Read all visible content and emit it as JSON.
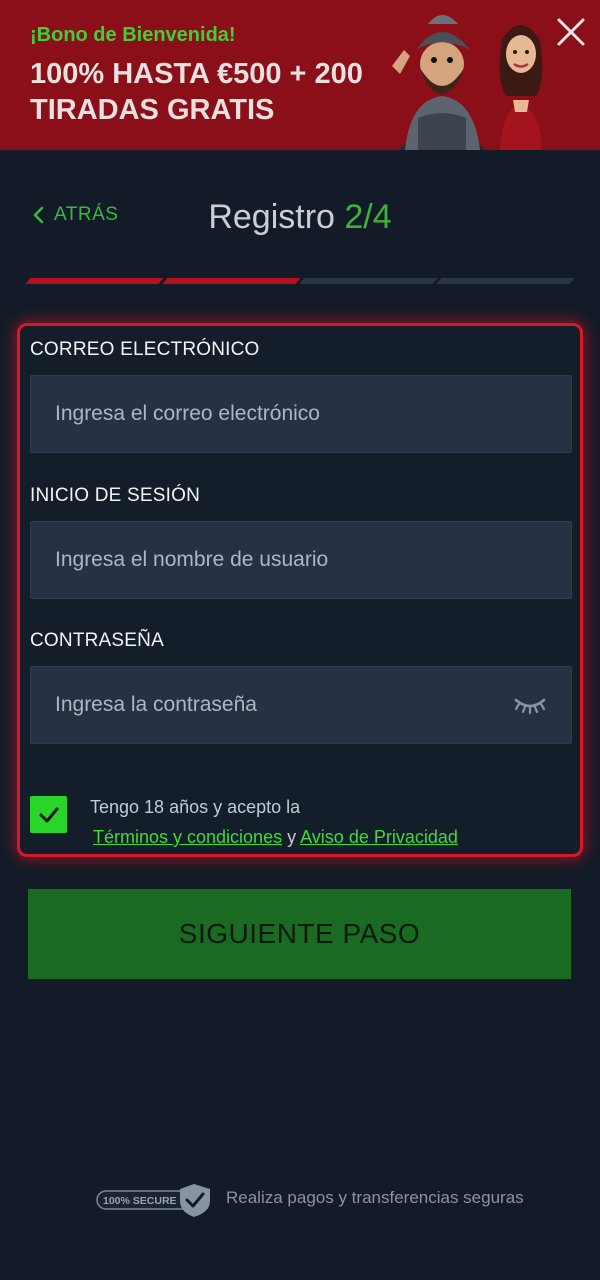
{
  "banner": {
    "kicker": "¡Bono de Bienvenida!",
    "headline": "100% HASTA €500 + 200 TIRADAS GRATIS",
    "close_icon": "close-icon"
  },
  "header": {
    "back_label": "ATRÁS",
    "title_text": "Registro",
    "title_step": "2/4",
    "progress": {
      "current_step": 2,
      "total_steps": 4
    }
  },
  "form": {
    "email": {
      "label": "CORREO ELECTRÓNICO",
      "placeholder": "Ingresa el correo electrónico",
      "value": ""
    },
    "username": {
      "label": "INICIO DE SESIÓN",
      "placeholder": "Ingresa el nombre de usuario",
      "value": ""
    },
    "password": {
      "label": "CONTRASEÑA",
      "placeholder": "Ingresa la contraseña",
      "value": "",
      "toggle_icon": "eye-closed-icon"
    },
    "terms": {
      "checked": true,
      "text": "Tengo 18 años y acepto la",
      "terms_link": "Términos y condiciones",
      "connector": "y",
      "privacy_link": "Aviso de Privacidad"
    }
  },
  "next_button": {
    "label": "SIGUIENTE PASO"
  },
  "footer": {
    "badge_text": "100% SECURE",
    "text": "Realiza pagos y transferencias seguras"
  },
  "colors": {
    "background": "#121b27",
    "banner": "#8a0f18",
    "accent_green": "#3fdc36",
    "accent_red": "#d41a2a",
    "button_green": "#1a6b21",
    "input_bg": "#263244"
  }
}
